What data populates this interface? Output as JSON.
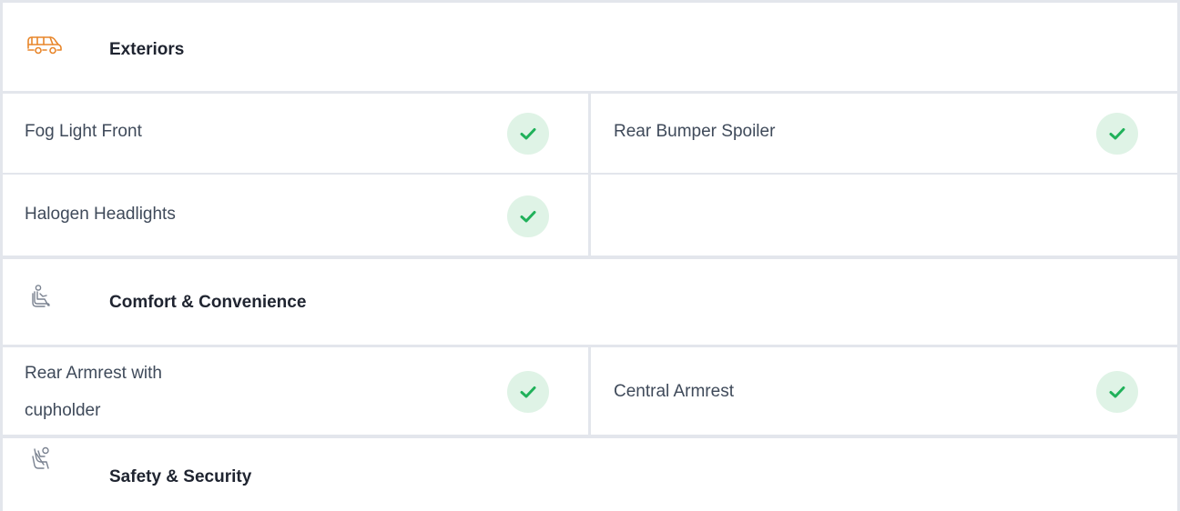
{
  "colors": {
    "accent_check": "#20b15a",
    "check_bg": "#dff3e6",
    "border": "#e3e6ec",
    "icon_orange": "#e8862b",
    "icon_gray": "#7a8290"
  },
  "sections": [
    {
      "title": "Exteriors",
      "icon": "car-icon",
      "features": [
        {
          "label": "Fog Light Front",
          "available": true
        },
        {
          "label": "Rear Bumper Spoiler",
          "available": true
        },
        {
          "label": "Halogen Headlights",
          "available": true
        }
      ]
    },
    {
      "title": "Comfort & Convenience",
      "icon": "seat-icon",
      "features": [
        {
          "label": "Rear Armrest with cupholder",
          "label_line1": "Rear Armrest with",
          "label_line2": "cupholder",
          "available": true
        },
        {
          "label": "Central Armrest",
          "available": true
        }
      ]
    },
    {
      "title": "Safety & Security",
      "icon": "seatbelt-icon",
      "features": []
    }
  ]
}
